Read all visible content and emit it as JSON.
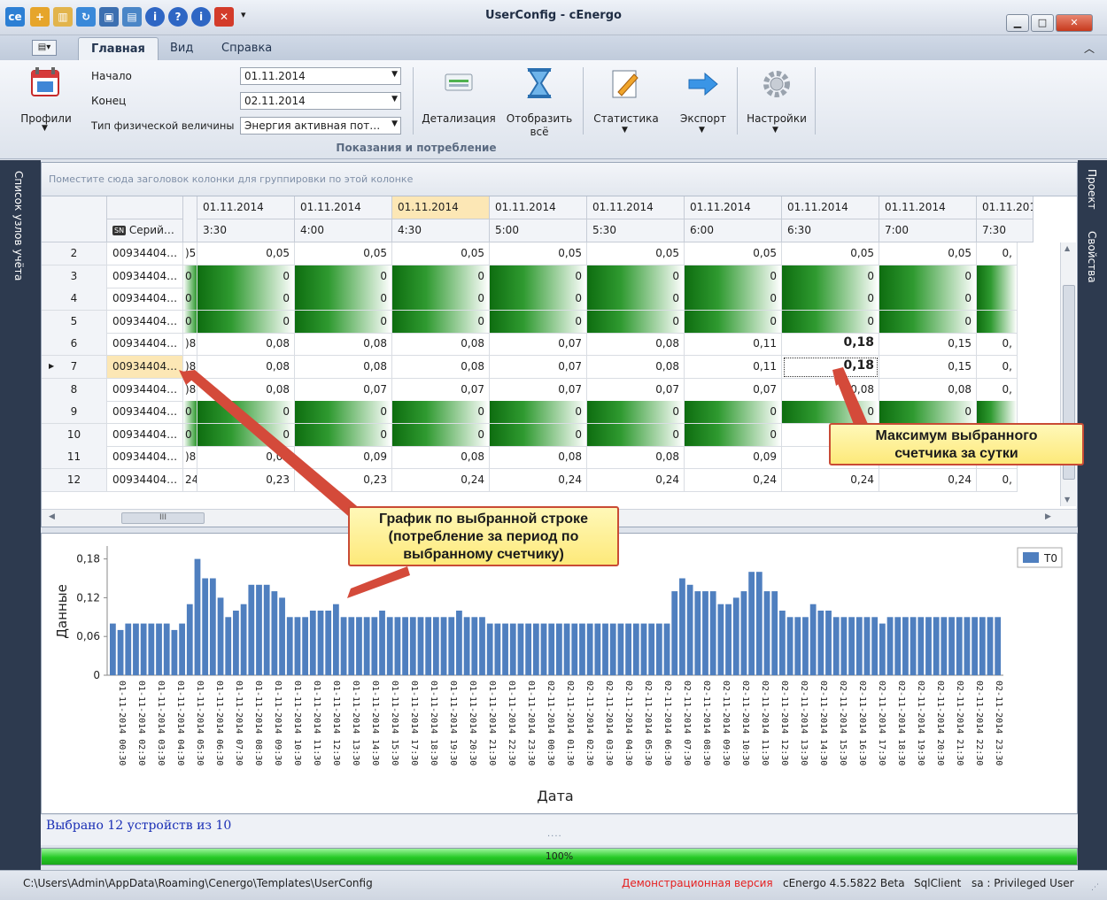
{
  "window": {
    "title": "UserConfig - cEnergo"
  },
  "tabs": [
    "Главная",
    "Вид",
    "Справка"
  ],
  "ribbon": {
    "profiles_label": "Профили",
    "start_label": "Начало",
    "start_value": "01.11.2014",
    "end_label": "Конец",
    "end_value": "02.11.2014",
    "type_label": "Тип физической величины",
    "type_value": "Энергия активная пот…",
    "detail_label": "Детализация",
    "show_all_label_1": "Отобразить",
    "show_all_label_2": "всё",
    "stats_label": "Статистика",
    "export_label": "Экспорт",
    "settings_label": "Настройки",
    "group_caption": "Показания и потребление"
  },
  "left_panel": {
    "label": "Список узлов учёта"
  },
  "right_panel": {
    "label_1": "Проект",
    "label_2": "Свойства"
  },
  "grid": {
    "group_hint": "Поместите сюда заголовок колонки для группировки по этой колонке",
    "serial_header": "Серий…",
    "serial_icon": "SN",
    "date_headers": [
      "01.11.2014",
      "01.11.2014",
      "01.11.2014",
      "01.11.2014",
      "01.11.2014",
      "01.11.2014",
      "01.11.2014",
      "01.11.2014",
      "01.11.2014"
    ],
    "time_headers": [
      "3:30",
      "4:00",
      "4:30",
      "5:00",
      "5:30",
      "6:00",
      "6:30",
      "7:00",
      "7:30"
    ],
    "rows": [
      {
        "num": "2",
        "serial": "00934404…",
        "partial": ")5",
        "cells": [
          "0,05",
          "0,05",
          "0,05",
          "0,05",
          "0,05",
          "0,05",
          "0,05",
          "0,05",
          "0,"
        ]
      },
      {
        "num": "3",
        "serial": "00934404…",
        "partial": "0",
        "cells": [
          "0",
          "0",
          "0",
          "0",
          "0",
          "0",
          "0",
          "0",
          ""
        ]
      },
      {
        "num": "4",
        "serial": "00934404…",
        "partial": "0",
        "cells": [
          "0",
          "0",
          "0",
          "0",
          "0",
          "0",
          "0",
          "0",
          ""
        ]
      },
      {
        "num": "5",
        "serial": "00934404…",
        "partial": "0",
        "cells": [
          "0",
          "0",
          "0",
          "0",
          "0",
          "0",
          "0",
          "0",
          ""
        ]
      },
      {
        "num": "6",
        "serial": "00934404…",
        "partial": ")8",
        "cells": [
          "0,08",
          "0,08",
          "0,08",
          "0,07",
          "0,08",
          "0,11",
          "0,18",
          "0,15",
          "0,"
        ]
      },
      {
        "num": "7",
        "serial": "00934404…",
        "partial": ")8",
        "cells": [
          "0,08",
          "0,08",
          "0,08",
          "0,07",
          "0,08",
          "0,11",
          "0,18",
          "0,15",
          "0,"
        ]
      },
      {
        "num": "8",
        "serial": "00934404…",
        "partial": ")8",
        "cells": [
          "0,08",
          "0,07",
          "0,07",
          "0,07",
          "0,07",
          "0,07",
          "0,08",
          "0,08",
          "0,"
        ]
      },
      {
        "num": "9",
        "serial": "00934404…",
        "partial": "0",
        "cells": [
          "0",
          "0",
          "0",
          "0",
          "0",
          "0",
          "0",
          "0",
          ""
        ]
      },
      {
        "num": "10",
        "serial": "00934404…",
        "partial": "0",
        "cells": [
          "0",
          "0",
          "0",
          "0",
          "0",
          "0",
          "",
          "",
          ""
        ]
      },
      {
        "num": "11",
        "serial": "00934404…",
        "partial": ")8",
        "cells": [
          "0,09",
          "0,09",
          "0,08",
          "0,08",
          "0,08",
          "0,09",
          "",
          "",
          ""
        ]
      },
      {
        "num": "12",
        "serial": "00934404…",
        "partial": "24",
        "cells": [
          "0,23",
          "0,23",
          "0,24",
          "0,24",
          "0,24",
          "0,24",
          "0,24",
          "0,24",
          "0,"
        ]
      }
    ],
    "hscroll_thumb": "III"
  },
  "callouts": {
    "max": [
      "Максимум выбранного",
      "счетчика за сутки"
    ],
    "chart": [
      "График по выбранной строке",
      "(потребление за период по",
      "выбранному счетчику)"
    ]
  },
  "chart_data": {
    "type": "bar",
    "xlabel": "Дата",
    "ylabel": "Данные",
    "ylim": [
      0,
      0.2
    ],
    "yticks": [
      "0",
      "0,06",
      "0,12",
      "0,18"
    ],
    "legend": "T0",
    "color": "#4f7fbf",
    "categories": [
      "01-11-2014 00:30",
      "01-11-2014 02:30",
      "01-11-2014 03:30",
      "01-11-2014 04:30",
      "01-11-2014 05:30",
      "01-11-2014 06:30",
      "01-11-2014 07:30",
      "01-11-2014 08:30",
      "01-11-2014 09:30",
      "01-11-2014 10:30",
      "01-11-2014 11:30",
      "01-11-2014 12:30",
      "01-11-2014 13:30",
      "01-11-2014 14:30",
      "01-11-2014 15:30",
      "01-11-2014 17:30",
      "01-11-2014 18:30",
      "01-11-2014 19:30",
      "01-11-2014 20:30",
      "01-11-2014 21:30",
      "01-11-2014 22:30",
      "01-11-2014 23:30",
      "02-11-2014 00:30",
      "02-11-2014 01:30",
      "02-11-2014 02:30",
      "02-11-2014 03:30",
      "02-11-2014 04:30",
      "02-11-2014 05:30",
      "02-11-2014 06:30",
      "02-11-2014 07:30",
      "02-11-2014 08:30",
      "02-11-2014 09:30",
      "02-11-2014 10:30",
      "02-11-2014 11:30",
      "02-11-2014 12:30",
      "02-11-2014 13:30",
      "02-11-2014 14:30",
      "02-11-2014 15:30",
      "02-11-2014 16:30",
      "02-11-2014 17:30",
      "02-11-2014 18:30",
      "02-11-2014 19:30",
      "02-11-2014 20:30",
      "02-11-2014 21:30",
      "02-11-2014 22:30",
      "02-11-2014 23:30"
    ],
    "values": [
      0.08,
      0.07,
      0.08,
      0.08,
      0.08,
      0.08,
      0.08,
      0.08,
      0.07,
      0.08,
      0.11,
      0.18,
      0.15,
      0.15,
      0.12,
      0.09,
      0.1,
      0.11,
      0.14,
      0.14,
      0.14,
      0.13,
      0.12,
      0.09,
      0.09,
      0.09,
      0.1,
      0.1,
      0.1,
      0.11,
      0.09,
      0.09,
      0.09,
      0.09,
      0.09,
      0.1,
      0.09,
      0.09,
      0.09,
      0.09,
      0.09,
      0.09,
      0.09,
      0.09,
      0.09,
      0.1,
      0.09,
      0.09,
      0.09,
      0.08,
      0.08,
      0.08,
      0.08,
      0.08,
      0.08,
      0.08,
      0.08,
      0.08,
      0.08,
      0.08,
      0.08,
      0.08,
      0.08,
      0.08,
      0.08,
      0.08,
      0.08,
      0.08,
      0.08,
      0.08,
      0.08,
      0.08,
      0.08,
      0.13,
      0.15,
      0.14,
      0.13,
      0.13,
      0.13,
      0.11,
      0.11,
      0.12,
      0.13,
      0.16,
      0.16,
      0.13,
      0.13,
      0.1,
      0.09,
      0.09,
      0.09,
      0.11,
      0.1,
      0.1,
      0.09,
      0.09,
      0.09,
      0.09,
      0.09,
      0.09,
      0.08,
      0.09,
      0.09,
      0.09,
      0.09,
      0.09,
      0.09,
      0.09,
      0.09,
      0.09,
      0.09,
      0.09,
      0.09,
      0.09,
      0.09,
      0.09
    ]
  },
  "status_line": "Выбрано 12 устройств из 10",
  "progress": {
    "value": 1.0,
    "label": "100%"
  },
  "statusbar": {
    "path": "C:\\Users\\Admin\\AppData\\Roaming\\Cenergo\\Templates\\UserConfig",
    "demo": "Демонстрационная версия",
    "version": "cEnergo 4.5.5822 Beta",
    "client": "SqlClient",
    "user": "sa : Privileged User"
  }
}
